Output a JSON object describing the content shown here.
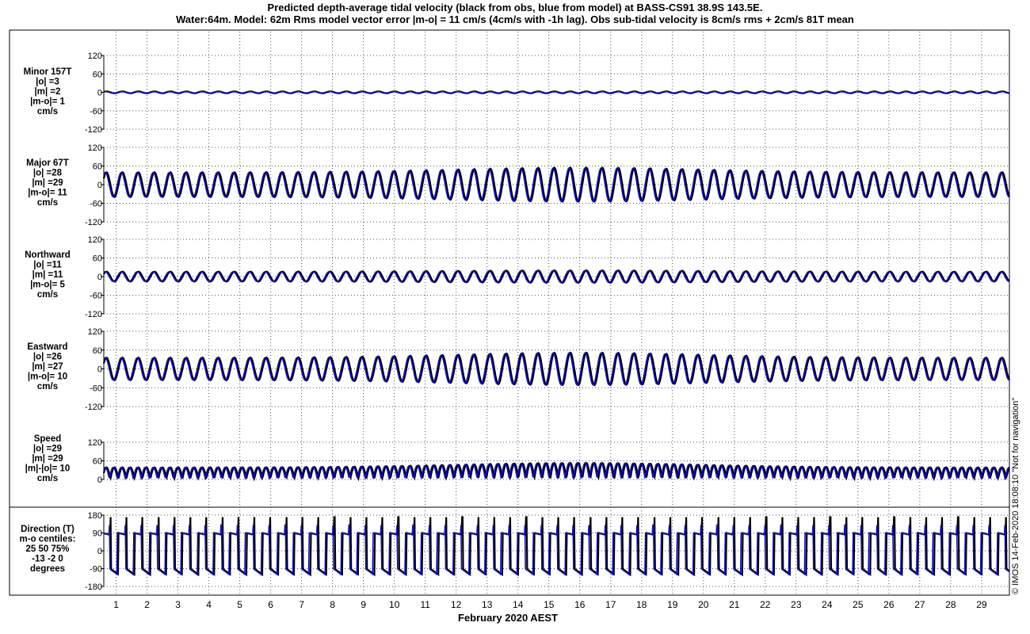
{
  "title": {
    "line1": "Predicted depth-average tidal velocity (black from obs, blue from model) at BASS-CS91 38.9S 143.5E.",
    "line2": "Water:64m. Model: 62m  Rms model vector error |m-o| = 11 cm/s (4cm/s with -1h lag). Obs sub-tidal velocity is 8cm/s rms + 2cm/s 81T mean"
  },
  "credit": "© IMOS 14-Feb-2020 18:08:10  \"Not for navigation\"",
  "colors": {
    "obs": "#000000",
    "model": "#1010c8",
    "grid": "#555555"
  },
  "chart_data": {
    "type": "line",
    "xlabel": "February 2020 AEST",
    "xlim": [
      0.6,
      29.9
    ],
    "xticks": [
      "1",
      "2",
      "3",
      "4",
      "5",
      "6",
      "7",
      "8",
      "9",
      "10",
      "11",
      "12",
      "13",
      "14",
      "15",
      "16",
      "17",
      "18",
      "19",
      "20",
      "21",
      "22",
      "23",
      "24",
      "25",
      "26",
      "27",
      "28",
      "29"
    ],
    "grid": true,
    "panels": [
      {
        "id": "minor",
        "label": [
          "Minor 157T",
          "|o| =3",
          "|m| =2",
          "|m-o|= 1",
          "cm/s"
        ],
        "ylim": [
          -120,
          120
        ],
        "yticks": [
          "120",
          "60",
          "0",
          "-60",
          "-120"
        ],
        "amplitude": 3,
        "series": [
          {
            "name": "obs",
            "style": "sinusoid"
          },
          {
            "name": "model",
            "style": "sinusoid"
          }
        ]
      },
      {
        "id": "major",
        "label": [
          "Major 67T",
          "|o| =28",
          "|m| =29",
          "|m-o|= 11",
          "cm/s"
        ],
        "ylim": [
          -120,
          120
        ],
        "yticks": [
          "120",
          "60",
          "0",
          "-60",
          "-120"
        ],
        "amplitude": 40,
        "amplitude_spring": 55,
        "series": [
          {
            "name": "obs",
            "style": "sinusoid"
          },
          {
            "name": "model",
            "style": "sinusoid"
          }
        ]
      },
      {
        "id": "northward",
        "label": [
          "Northward",
          "|o| =11",
          "|m| =11",
          "|m-o|= 5",
          "cm/s"
        ],
        "ylim": [
          -120,
          120
        ],
        "yticks": [
          "120",
          "60",
          "0",
          "-60",
          "-120"
        ],
        "amplitude": 16,
        "amplitude_spring": 20,
        "series": [
          {
            "name": "obs",
            "style": "sinusoid"
          },
          {
            "name": "model",
            "style": "sinusoid"
          }
        ]
      },
      {
        "id": "eastward",
        "label": [
          "Eastward",
          "|o| =26",
          "|m| =27",
          "|m-o|= 10",
          "cm/s"
        ],
        "ylim": [
          -120,
          120
        ],
        "yticks": [
          "120",
          "60",
          "0",
          "-60",
          "-120"
        ],
        "amplitude": 36,
        "amplitude_spring": 52,
        "series": [
          {
            "name": "obs",
            "style": "sinusoid"
          },
          {
            "name": "model",
            "style": "sinusoid"
          }
        ]
      },
      {
        "id": "speed",
        "label": [
          "Speed",
          "|o| =29",
          "|m| =29",
          "|m|-|o|= 10",
          "cm/s"
        ],
        "ylim": [
          0,
          120
        ],
        "yticks": [
          "120",
          "60",
          "0"
        ],
        "amplitude": 40,
        "amplitude_spring": 56,
        "series": [
          {
            "name": "obs",
            "style": "abs-sinusoid"
          },
          {
            "name": "model",
            "style": "abs-sinusoid"
          }
        ]
      },
      {
        "id": "direction",
        "label": [
          "Direction (T)",
          "m-o centiles:",
          "25  50  75%",
          "-13  -2   0",
          "degrees"
        ],
        "ylim": [
          -180,
          180
        ],
        "yticks": [
          "180",
          "90",
          "0",
          "-90",
          "-180"
        ],
        "series": [
          {
            "name": "obs",
            "style": "sawtooth"
          },
          {
            "name": "model",
            "style": "sawtooth"
          }
        ]
      }
    ]
  }
}
